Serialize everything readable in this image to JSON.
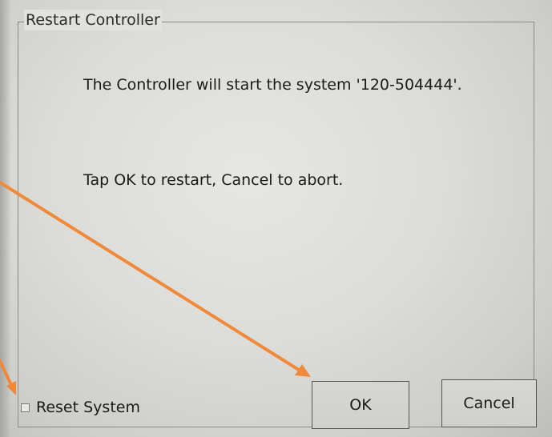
{
  "dialog": {
    "title": "Restart Controller",
    "message_line1": "The Controller will start the system '120-504444'.",
    "message_line2": "Tap OK to restart, Cancel to abort."
  },
  "options": {
    "reset_system_label": "Reset System",
    "reset_system_checked": false
  },
  "buttons": {
    "ok_label": "OK",
    "cancel_label": "Cancel"
  },
  "annotation": {
    "arrow_color": "#f08a3a"
  }
}
